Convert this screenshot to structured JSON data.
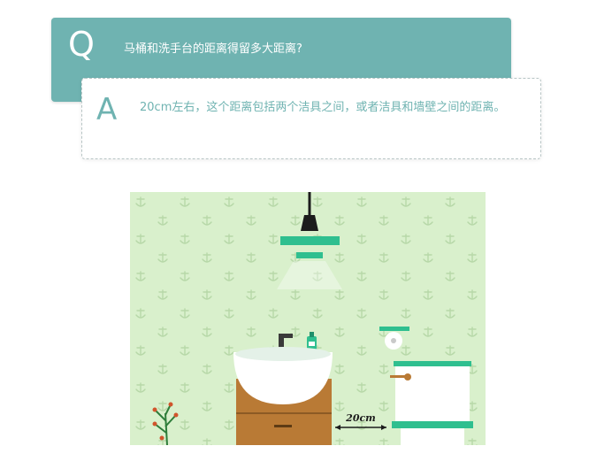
{
  "question": {
    "letter": "Q",
    "text": "马桶和洗手台的距离得留多大距离?"
  },
  "answer": {
    "letter": "A",
    "text": "20cm左右，这个距离包括两个洁具之间，或者洁具和墙壁之间的距离。"
  },
  "illustration": {
    "distance_label": "20cm",
    "colors": {
      "wallpaper": "#d9f0cc",
      "accent": "#2fbf8f",
      "cabinet": "#b97a35",
      "sink": "#ffffff"
    }
  }
}
